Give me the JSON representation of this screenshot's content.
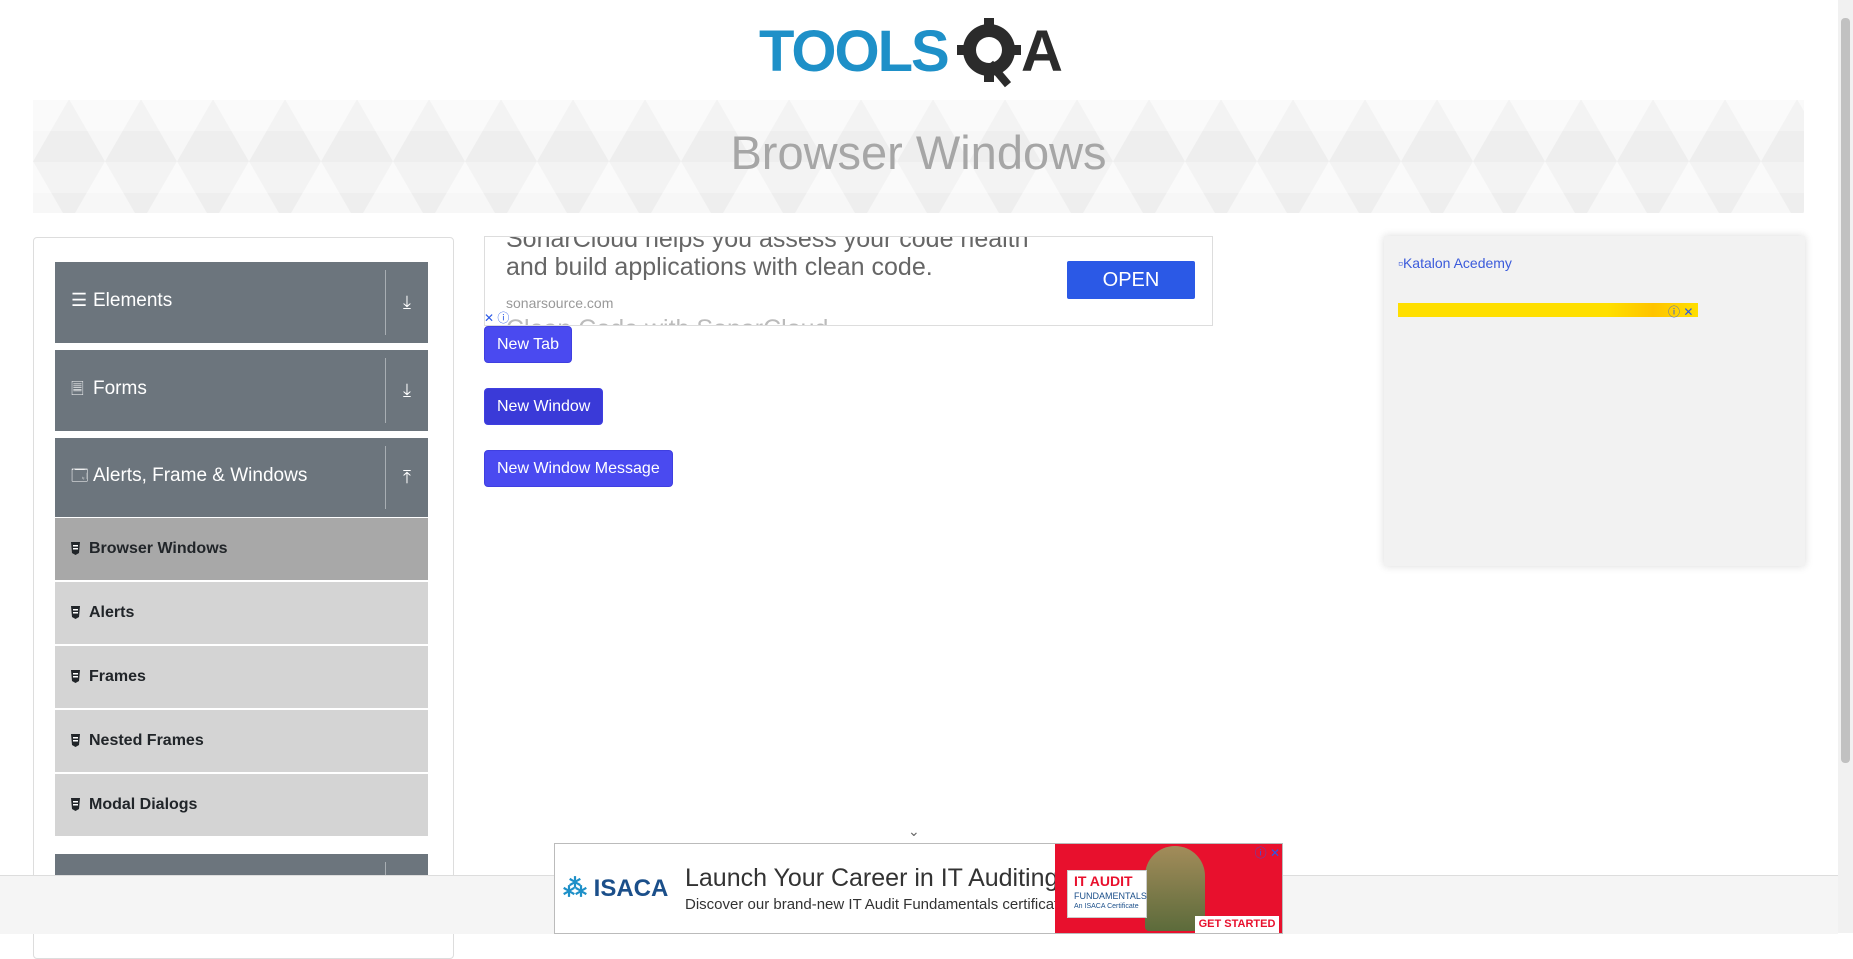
{
  "header": {
    "logo_text": "TOOLSQA"
  },
  "page": {
    "title": "Browser Windows"
  },
  "sidebar": {
    "groups": [
      {
        "label": "Elements",
        "icon": "hamburger-icon",
        "expanded": false
      },
      {
        "label": "Forms",
        "icon": "document-icon",
        "expanded": false
      },
      {
        "label": "Alerts, Frame & Windows",
        "icon": "window-icon",
        "expanded": true
      }
    ],
    "items": [
      {
        "label": "Browser Windows",
        "active": true
      },
      {
        "label": "Alerts",
        "active": false
      },
      {
        "label": "Frames",
        "active": false
      },
      {
        "label": "Nested Frames",
        "active": false
      },
      {
        "label": "Modal Dialogs",
        "active": false
      }
    ]
  },
  "ad_top": {
    "text": "SonarCloud helps you assess your code health and build applications with clean code.",
    "url": "sonarsource.com",
    "button": "OPEN",
    "partial": "Clean Code with SonarCloud"
  },
  "buttons": {
    "new_tab": "New Tab",
    "new_window": "New Window",
    "new_window_message": "New Window Message"
  },
  "right_ad": {
    "image_alt": "Katalon Acedemy"
  },
  "bottom_ad": {
    "brand": "ISACA",
    "headline": "Launch Your Career in IT Auditing",
    "sub": "Discover our brand-new IT Audit Fundamentals certificate.",
    "badge_title": "IT AUDIT",
    "badge_sub": "FUNDAMENTALS",
    "badge_small": "An ISACA Certificate",
    "cta": "GET STARTED"
  },
  "colors": {
    "accent": "#4a4af0",
    "sidebar_group": "#6c757d",
    "sidebar_item": "#d4d4d4",
    "sidebar_active": "#a8a8a8"
  }
}
